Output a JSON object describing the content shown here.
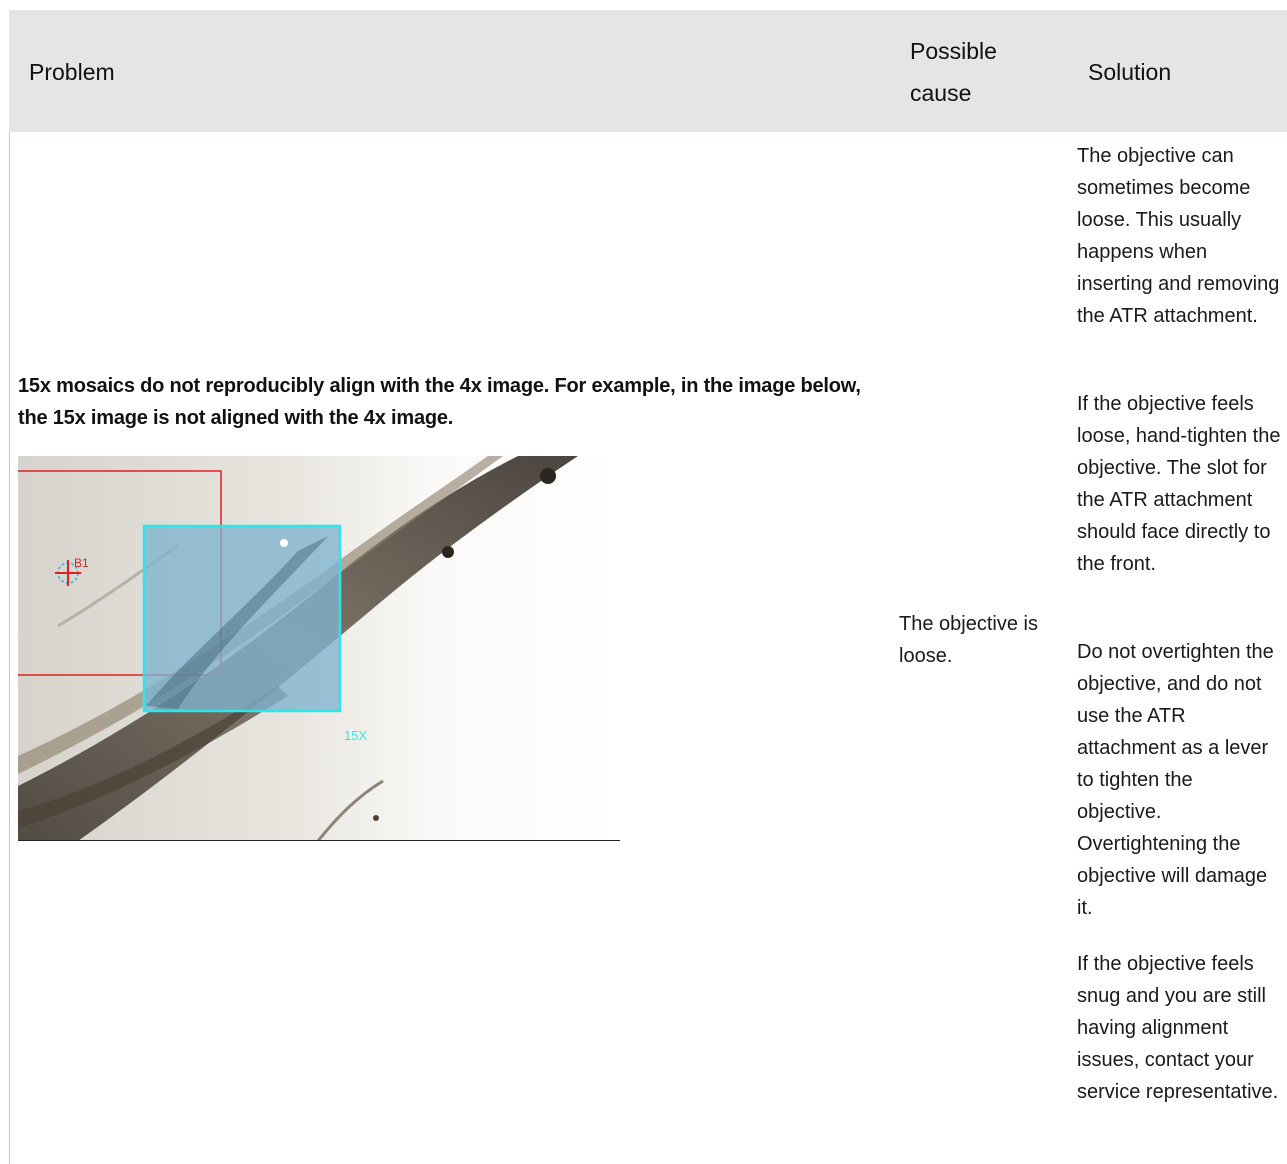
{
  "table": {
    "headers": {
      "problem": "Problem",
      "cause": "Possible cause",
      "solution": "Solution"
    },
    "row": {
      "problem": "15x mosaics do not reproducibly align with the 4x image. For example, in the image below, the 15x image is not aligned with the 4x image.",
      "cause": "The objective is loose.",
      "solutions": [
        "The objective can sometimes become loose. This usually happens when inserting and removing the ATR attachment.",
        "If the objective feels loose, hand-tighten the objective. The slot for the ATR attachment should face directly to the front.",
        "Do not overtighten the objective, and do not use the ATR attachment as a lever to tighten the objective. Overtightening the objective will damage it.",
        "If the objective feels snug and you are still having alignment issues, contact your service representative."
      ]
    },
    "figure": {
      "marker_label": "B1",
      "overlay_label": "15X",
      "colors": {
        "marker": "#e02020",
        "overlay_border": "#2fe6e6",
        "overlay_fill": "#7fb3d0"
      }
    }
  }
}
